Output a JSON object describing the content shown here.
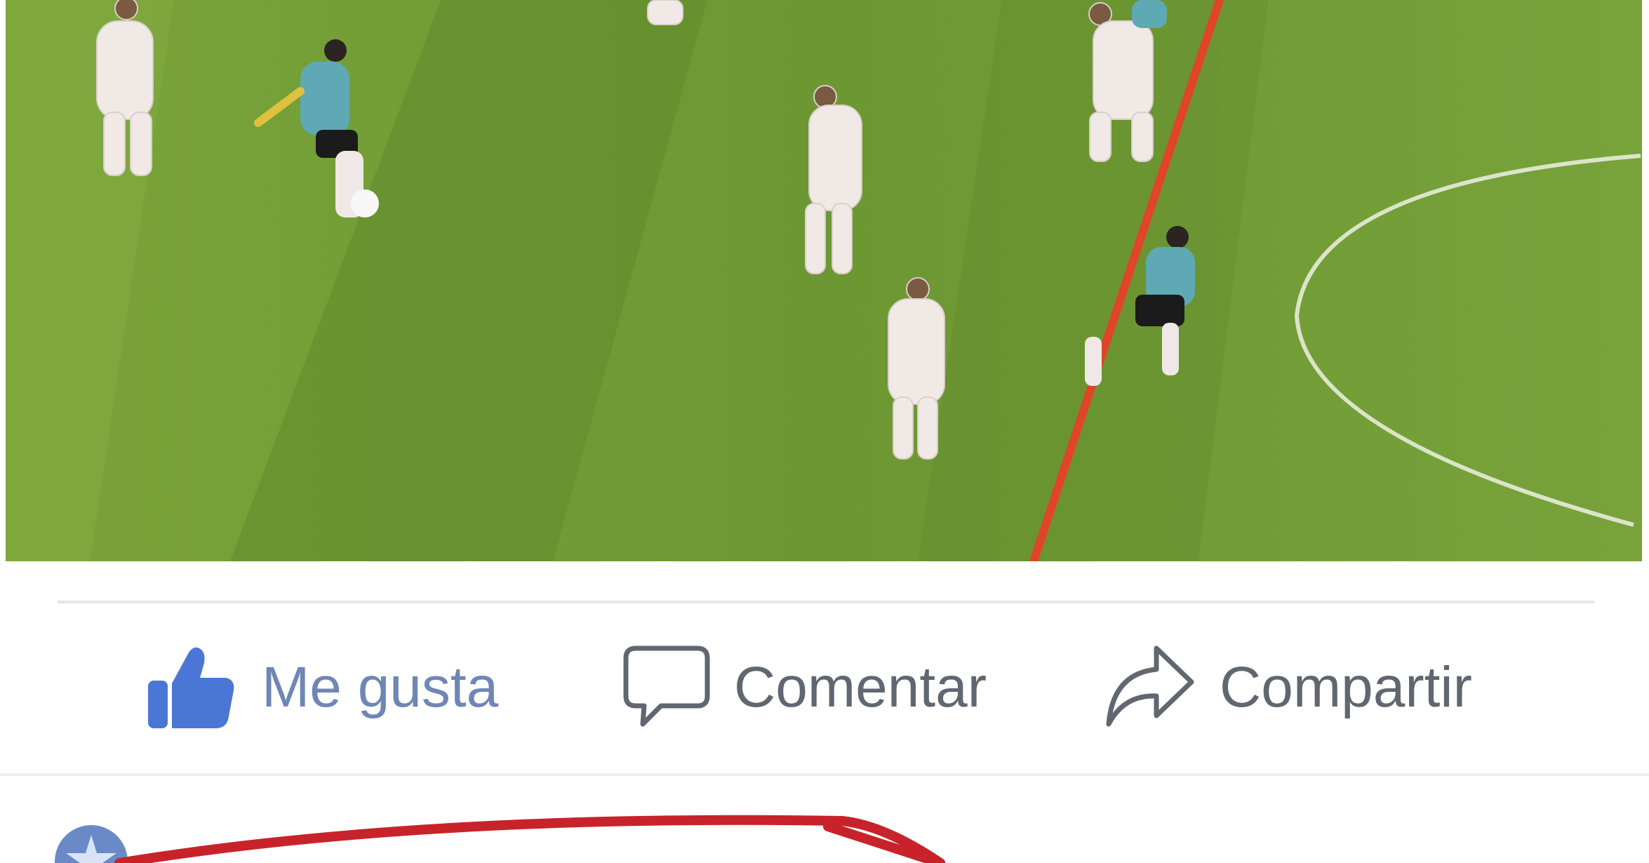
{
  "actions": {
    "like_label": "Me gusta",
    "comment_label": "Comentar",
    "share_label": "Compartir"
  },
  "icons": {
    "like": "thumbs-up-icon",
    "comment": "speech-bubble-icon",
    "share": "share-arrow-icon"
  },
  "comment": {
    "author_name": ""
  },
  "colors": {
    "like_blue": "#4a76d6",
    "action_gray": "#606770",
    "pitch_green": "#6d9a32",
    "offside_line_red": "#e0452a",
    "annotation_red": "#c8232b"
  }
}
